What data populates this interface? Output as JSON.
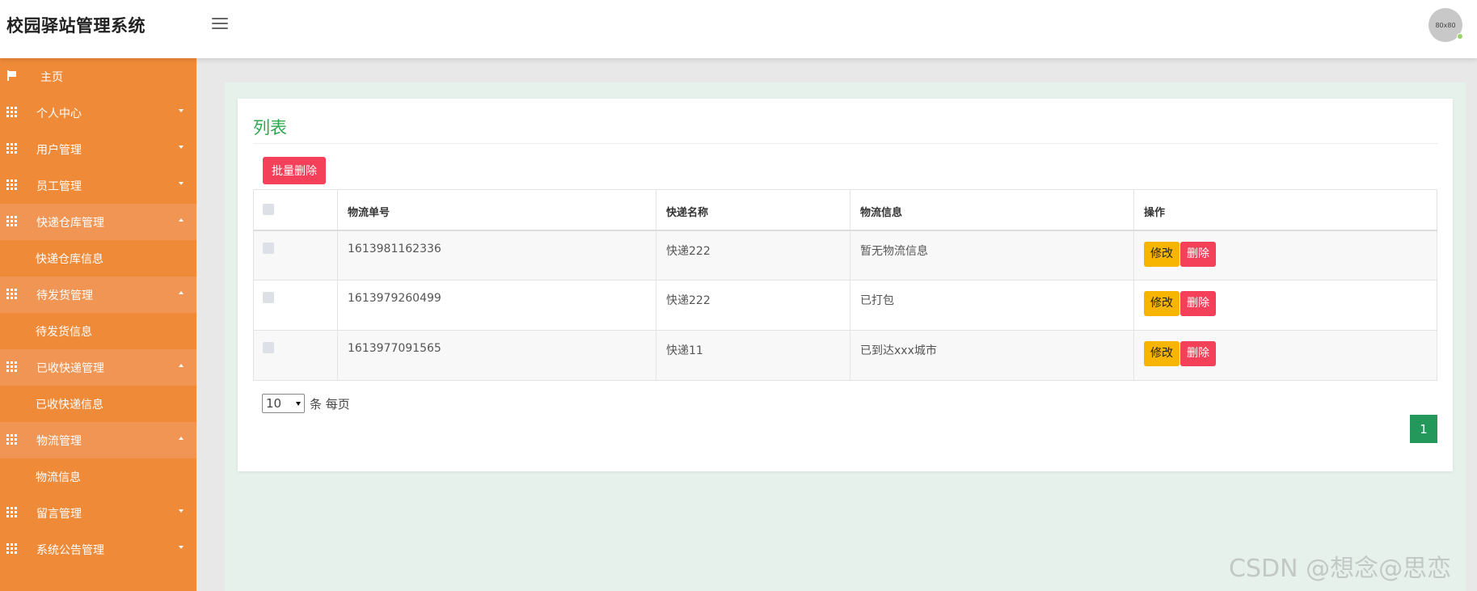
{
  "app": {
    "title": "校园驿站管理系统"
  },
  "header": {
    "avatar_text": "80x80"
  },
  "sidebar": {
    "home": "主页",
    "groups": [
      {
        "label": "个人中心",
        "open": false
      },
      {
        "label": "用户管理",
        "open": false
      },
      {
        "label": "员工管理",
        "open": false
      },
      {
        "label": "快递仓库管理",
        "open": true,
        "sub": "快递仓库信息"
      },
      {
        "label": "待发货管理",
        "open": true,
        "sub": "待发货信息"
      },
      {
        "label": "已收快递管理",
        "open": true,
        "sub": "已收快递信息"
      },
      {
        "label": "物流管理",
        "open": true,
        "sub": "物流信息"
      },
      {
        "label": "留言管理",
        "open": false
      },
      {
        "label": "系统公告管理",
        "open": false
      }
    ]
  },
  "main": {
    "title": "列表",
    "batch_delete_label": "批量删除",
    "columns": [
      "物流单号",
      "快递名称",
      "物流信息",
      "操作"
    ],
    "rows": [
      {
        "no": "1613981162336",
        "name": "快递222",
        "info": "暂无物流信息"
      },
      {
        "no": "1613979260499",
        "name": "快递222",
        "info": "已打包"
      },
      {
        "no": "1613977091565",
        "name": "快递11",
        "info": "已到达xxx城市"
      }
    ],
    "edit_label": "修改",
    "delete_label": "删除",
    "page_size_value": "10",
    "page_size_suffix": "条 每页",
    "current_page": "1"
  },
  "watermark": "CSDN @想念@思恋",
  "colors": {
    "sidebar": "#ef8a39",
    "accent_green": "#2ea84f",
    "danger": "#f44058",
    "warning": "#f7b500"
  }
}
